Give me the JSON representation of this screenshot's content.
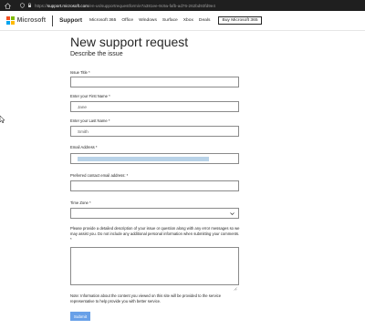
{
  "browser": {
    "url_prefix": "https://",
    "url_host": "support.microsoft.com",
    "url_path": "/en-us/supportrequestform/e7a381ee-9c9a-fafb-ad76-262bd93fd9e4"
  },
  "header": {
    "brand": "Microsoft",
    "section": "Support",
    "nav": [
      "Microsoft 365",
      "Office",
      "Windows",
      "Surface",
      "Xbox",
      "Deals"
    ],
    "buy_button": "Buy Microsoft 365",
    "logo_colors": [
      "#f25022",
      "#7fba00",
      "#00a4ef",
      "#ffb900"
    ]
  },
  "page": {
    "title": "New support request",
    "subtitle": "Describe the issue"
  },
  "form": {
    "issue_title_label": "Issue Title *",
    "issue_title_value": "",
    "first_name_label": "Enter your First Name *",
    "first_name_value": "Jane",
    "last_name_label": "Enter your Last Name *",
    "last_name_value": "Smith",
    "email_label": "Email Address *",
    "preferred_email_label": "Preferred contact email address: *",
    "preferred_email_value": "",
    "timezone_label": "Time Zone *",
    "timezone_value": "",
    "description_label": "Please provide a detailed description of your issue or question along with any error messages so we may assist you. Do not include any additional personal information when submitting your comments. *",
    "note": "Note: Information about the content you viewed on this site will be provided to the service representative to help provide you with better service.",
    "submit_label": "Submit"
  },
  "colors": {
    "accent": "#68a0e8",
    "selection": "#b9d3e8"
  }
}
